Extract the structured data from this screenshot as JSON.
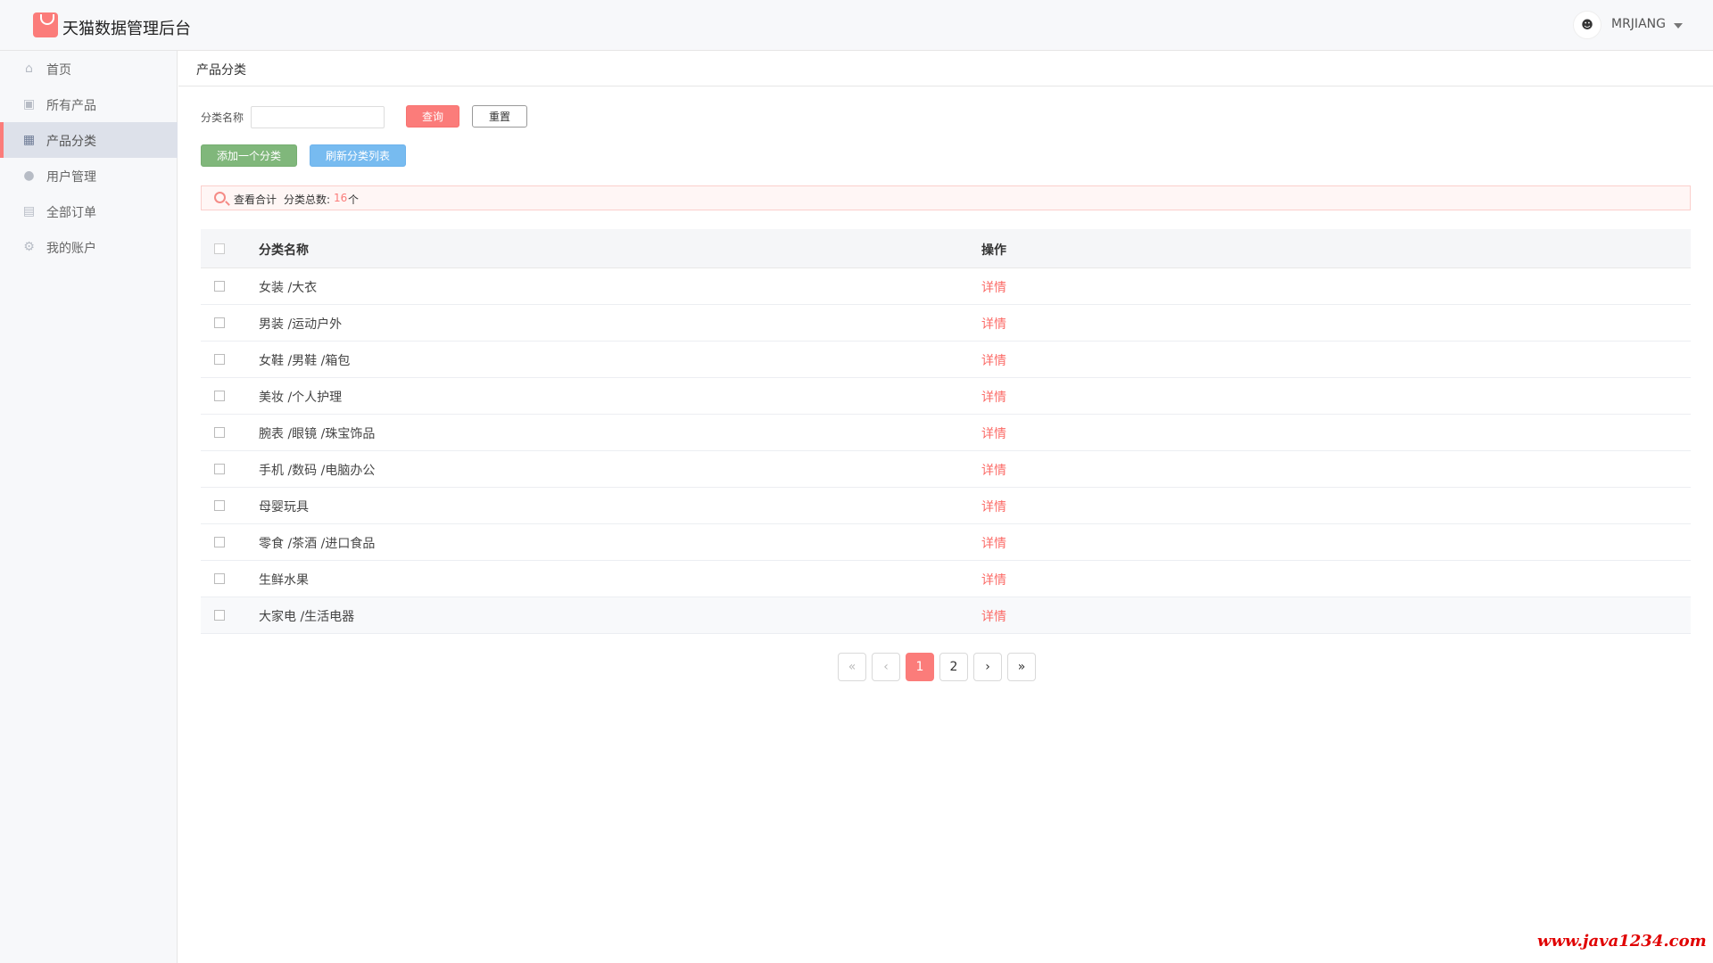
{
  "header": {
    "app_title": "天猫数据管理后台",
    "user_name": "MRJIANG"
  },
  "sidebar": {
    "items": [
      {
        "label": "首页",
        "icon": "home-icon"
      },
      {
        "label": "所有产品",
        "icon": "product-icon"
      },
      {
        "label": "产品分类",
        "icon": "category-icon",
        "active": true
      },
      {
        "label": "用户管理",
        "icon": "user-icon"
      },
      {
        "label": "全部订单",
        "icon": "order-icon"
      },
      {
        "label": "我的账户",
        "icon": "gear-icon"
      }
    ]
  },
  "breadcrumb": {
    "title": "产品分类"
  },
  "filter": {
    "label": "分类名称",
    "value": "",
    "placeholder": "",
    "query_label": "查询",
    "reset_label": "重置"
  },
  "actions": {
    "add_label": "添加一个分类",
    "refresh_label": "刷新分类列表"
  },
  "summary": {
    "title": "查看合计",
    "count_label": "分类总数:",
    "count": "16",
    "unit": "个"
  },
  "table": {
    "headers": {
      "name": "分类名称",
      "operation": "操作"
    },
    "rows": [
      {
        "name": "女装 /大衣",
        "op": "详情"
      },
      {
        "name": "男装 /运动户外",
        "op": "详情"
      },
      {
        "name": "女鞋 /男鞋 /箱包",
        "op": "详情"
      },
      {
        "name": "美妆 /个人护理",
        "op": "详情"
      },
      {
        "name": "腕表 /眼镜 /珠宝饰品",
        "op": "详情"
      },
      {
        "name": "手机 /数码 /电脑办公",
        "op": "详情"
      },
      {
        "name": "母婴玩具",
        "op": "详情"
      },
      {
        "name": "零食 /茶酒 /进口食品",
        "op": "详情"
      },
      {
        "name": "生鲜水果",
        "op": "详情"
      },
      {
        "name": "大家电 /生活电器",
        "op": "详情"
      }
    ]
  },
  "pagination": {
    "first": "«",
    "prev": "‹",
    "pages": [
      "1",
      "2"
    ],
    "current": "1",
    "next": "›",
    "last": "»"
  },
  "watermark": "www.java1234.com",
  "colors": {
    "accent": "#fb7c7a",
    "add_button": "#80b77b",
    "refresh_button": "#77bbf0",
    "link": "#fb6b67"
  }
}
